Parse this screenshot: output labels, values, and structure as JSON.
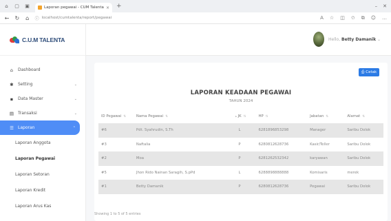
{
  "browser": {
    "tab_title": "Laporan pegawai - CUM Talenta",
    "tab_close": "×",
    "new_tab": "+",
    "url": "localhost/cumtalenta/report/pegawai"
  },
  "sidebar": {
    "brand": "C.U.M TALENTA",
    "brand_colors": [
      "#e23b3b",
      "#2f9b46",
      "#2c6fd1"
    ],
    "items": [
      {
        "label": "Dashboard",
        "icon": "home-icon"
      },
      {
        "label": "Setting",
        "icon": "gear-icon"
      },
      {
        "label": "Data Master",
        "icon": "database-icon"
      },
      {
        "label": "Transaksi",
        "icon": "document-icon"
      },
      {
        "label": "Laporan",
        "icon": "list-icon"
      }
    ],
    "sub_items": [
      "Laporan Anggota",
      "Laporan Pegawai",
      "Laporan Setoran",
      "Laporan Kredit",
      "Laporan Arus Kas"
    ]
  },
  "header": {
    "hello": "Hello,",
    "user": "Betty Damanik"
  },
  "report": {
    "print_label": "Cetak",
    "title": "LAPORAN KEADAAN PEGAWAI",
    "subtitle": "TAHUN 2024",
    "columns": [
      "ID Pegawai",
      "Nama Pegawai",
      "JK",
      "HP",
      "Jabatan",
      "Alamat"
    ],
    "rows": [
      [
        "#6",
        "Pdt. Syahrudin, S.Th",
        "L",
        "6281896853298",
        "Manager",
        "Saribu Dolok"
      ],
      [
        "#3",
        "Naftalia",
        "P",
        "6280812628736",
        "Kasir/Teller",
        "Saribu Dolok"
      ],
      [
        "#2",
        "Moa",
        "P",
        "6281262532342",
        "karyawan",
        "Saribu Dolok"
      ],
      [
        "#5",
        "Jhon Rido Nainan Saragih, S.pPd",
        "L",
        "6288898888888",
        "Komisaris",
        "merek"
      ],
      [
        "#1",
        "Betty Damanik",
        "P",
        "6280812628736",
        "Pegawai",
        "Saribu Dolok"
      ]
    ],
    "showing": "Showing 1 to 5 of 5 entries"
  }
}
